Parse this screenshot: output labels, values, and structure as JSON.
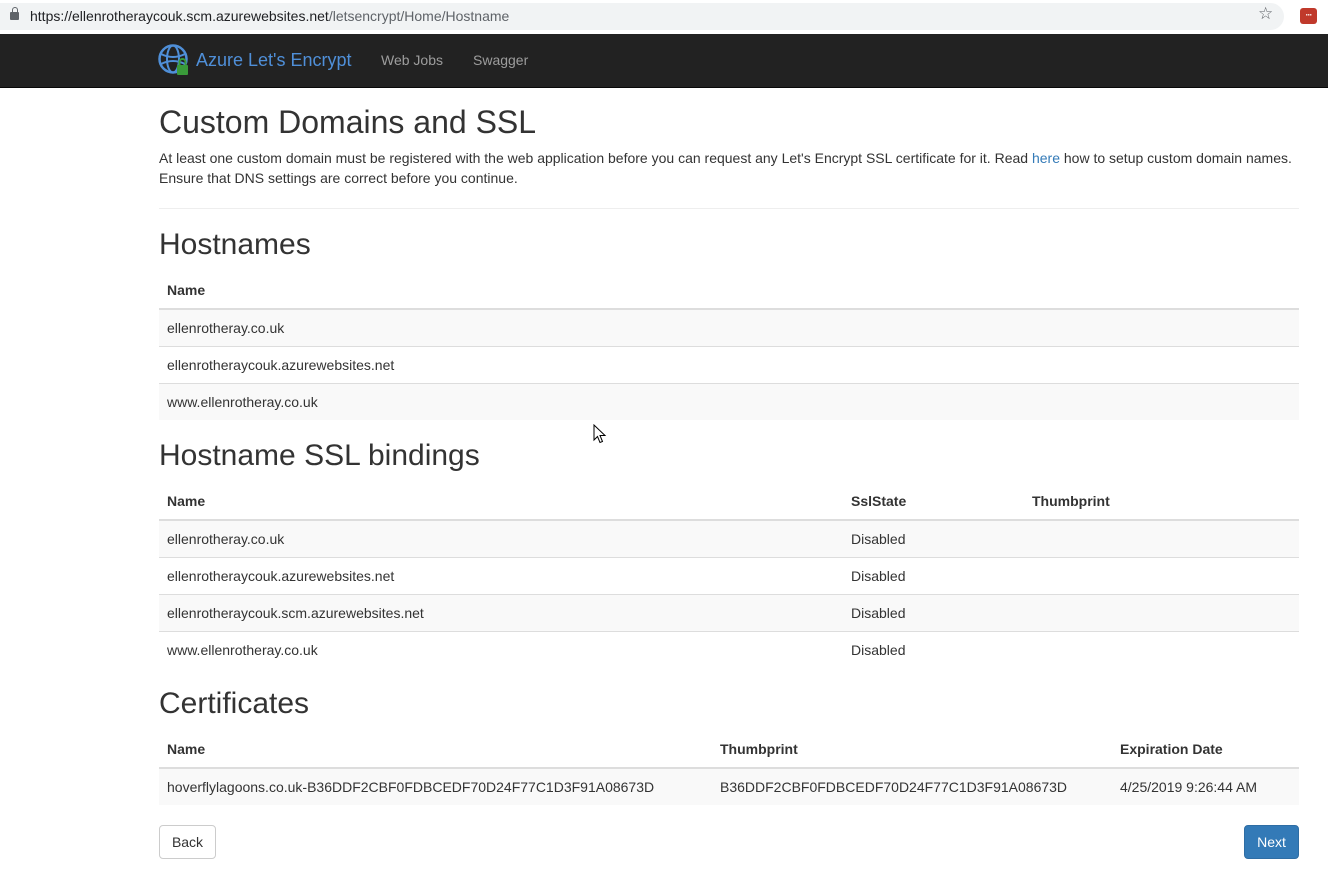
{
  "browser": {
    "url_host": "https://ellenrotheraycouk.scm.azurewebsites.net",
    "url_path": "/letsencrypt/Home/Hostname",
    "icons": [
      "lock-icon",
      "star-icon",
      "extension-icon"
    ]
  },
  "navbar": {
    "brand": "Azure Let's Encrypt",
    "links": [
      "Web Jobs",
      "Swagger"
    ],
    "colors": {
      "background": "#222222",
      "brand": "#4f8fd8",
      "link": "#9d9d9d"
    }
  },
  "page": {
    "title": "Custom Domains and SSL",
    "intro_before_link": "At least one custom domain must be registered with the web application before you can request any Let's Encrypt SSL certificate for it. Read ",
    "intro_link": "here",
    "intro_after_link": " how to setup custom domain names. Ensure that DNS settings are correct before you continue."
  },
  "hostnames": {
    "heading": "Hostnames",
    "columns": [
      "Name"
    ],
    "rows": [
      [
        "ellenrotheray.co.uk"
      ],
      [
        "ellenrotheraycouk.azurewebsites.net"
      ],
      [
        "www.ellenrotheray.co.uk"
      ]
    ]
  },
  "bindings": {
    "heading": "Hostname SSL bindings",
    "columns": [
      "Name",
      "SslState",
      "Thumbprint"
    ],
    "rows": [
      [
        "ellenrotheray.co.uk",
        "Disabled",
        ""
      ],
      [
        "ellenrotheraycouk.azurewebsites.net",
        "Disabled",
        ""
      ],
      [
        "ellenrotheraycouk.scm.azurewebsites.net",
        "Disabled",
        ""
      ],
      [
        "www.ellenrotheray.co.uk",
        "Disabled",
        ""
      ]
    ]
  },
  "certificates": {
    "heading": "Certificates",
    "columns": [
      "Name",
      "Thumbprint",
      "Expiration Date"
    ],
    "rows": [
      [
        "hoverflylagoons.co.uk-B36DDF2CBF0FDBCEDF70D24F77C1D3F91A08673D",
        "B36DDF2CBF0FDBCEDF70D24F77C1D3F91A08673D",
        "4/25/2019 9:26:44 AM"
      ]
    ]
  },
  "buttons": {
    "back": "Back",
    "next": "Next",
    "colors": {
      "primary": "#337ab7"
    }
  }
}
